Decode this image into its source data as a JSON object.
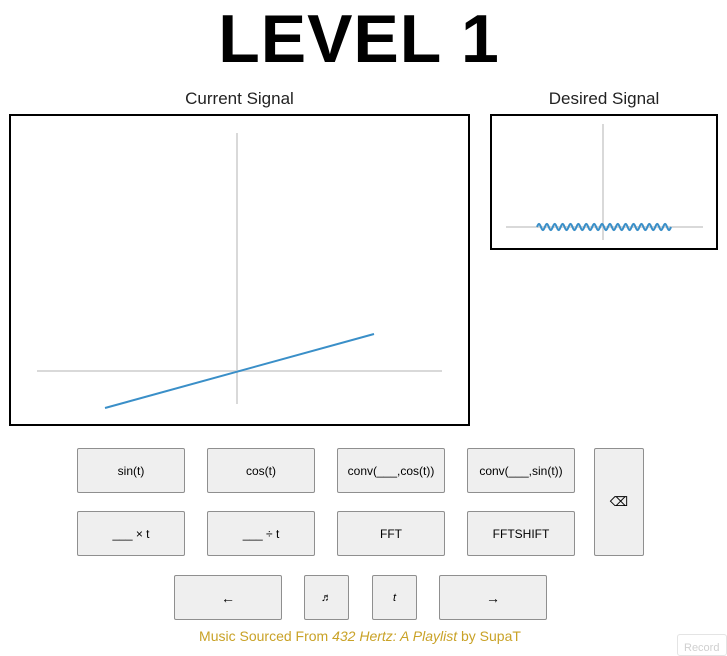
{
  "title": "LEVEL 1",
  "current_signal": {
    "label": "Current Signal",
    "line_color": "#3a8fc8",
    "axis_color": "#d9d9d9"
  },
  "desired_signal": {
    "label": "Desired Signal",
    "line_color": "#3a8fc8",
    "axis_color": "#d9d9d9"
  },
  "buttons": {
    "sin": "sin(t)",
    "cos": "cos(t)",
    "conv_cos": "conv(___,cos(t))",
    "conv_sin": "conv(___,sin(t))",
    "backspace": "⌫",
    "times_t": "___ × t",
    "div_t": "___ ÷ t",
    "fft": "FFT",
    "fftshift": "FFTSHIFT",
    "left": "←",
    "music": "♬",
    "t": "t",
    "right": "→"
  },
  "credit": {
    "prefix": "Music Sourced From ",
    "title": "432 Hertz: A Playlist",
    "suffix": " by SupaT"
  },
  "record_label": "Record"
}
